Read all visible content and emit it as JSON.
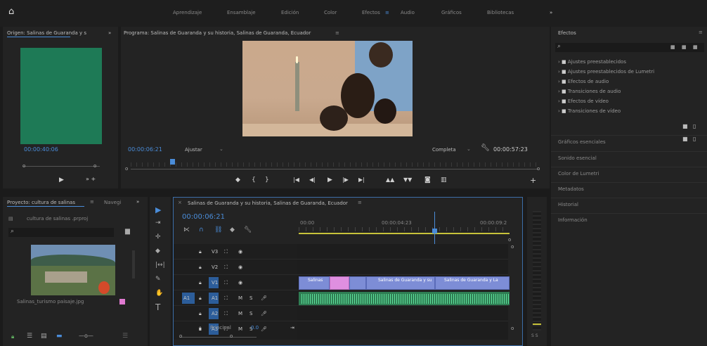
{
  "topnav": {
    "tabs": [
      "Aprendizaje",
      "Ensamblaje",
      "Edición",
      "Color",
      "Efectos",
      "Audio",
      "Gráficos",
      "Bibliotecas"
    ],
    "active": "Efectos",
    "more": "»"
  },
  "source": {
    "title": "Origen: Salinas de Guaranda y s",
    "more": "»",
    "timecode": "00:00:40:06",
    "bg": "#1e7a56"
  },
  "program": {
    "title": "Programa: Salinas de Guaranda y su historia, Salinas de Guaranda, Ecuador",
    "menu": "≡",
    "timecode": "00:00:06:21",
    "fit": "Ajustar",
    "quality": "Completa",
    "duration": "00:00:57:23"
  },
  "effects": {
    "title": "Efectos",
    "items": [
      "Ajustes preestablecidos",
      "Ajustes preestablecidos de Lumetri",
      "Efectos de audio",
      "Transiciones de audio",
      "Efectos de vídeo",
      "Transiciones de vídeo"
    ],
    "panels": [
      "Gráficos esenciales",
      "Sonido esencial",
      "Color de Lumetri",
      "Metadatos",
      "Historial",
      "Información"
    ]
  },
  "project": {
    "title": "Proyecto: cultura de salinas",
    "menu": "≡",
    "nav": "Navegi",
    "more": "»",
    "file": "cultura de salinas .prproj",
    "clip": "Salinas_turismo paisaje.jpg"
  },
  "timeline": {
    "title": "Salinas de Guaranda y su historia, Salinas de Guaranda, Ecuador",
    "menu": "≡",
    "timecode": "00:00:06:21",
    "ruler": [
      "00:00",
      "00:00:04:23",
      "00:00:09:2"
    ],
    "tracks": [
      "V3",
      "V2",
      "V1",
      "A1",
      "A2",
      "A3"
    ],
    "src": "A1",
    "mix": "Principal",
    "mixval": "0.0",
    "clips": [
      "Salinas",
      "Salinas de Guaranda y su",
      "Salinas de Guaranda y La"
    ]
  },
  "meter": {
    "label": "S S"
  }
}
